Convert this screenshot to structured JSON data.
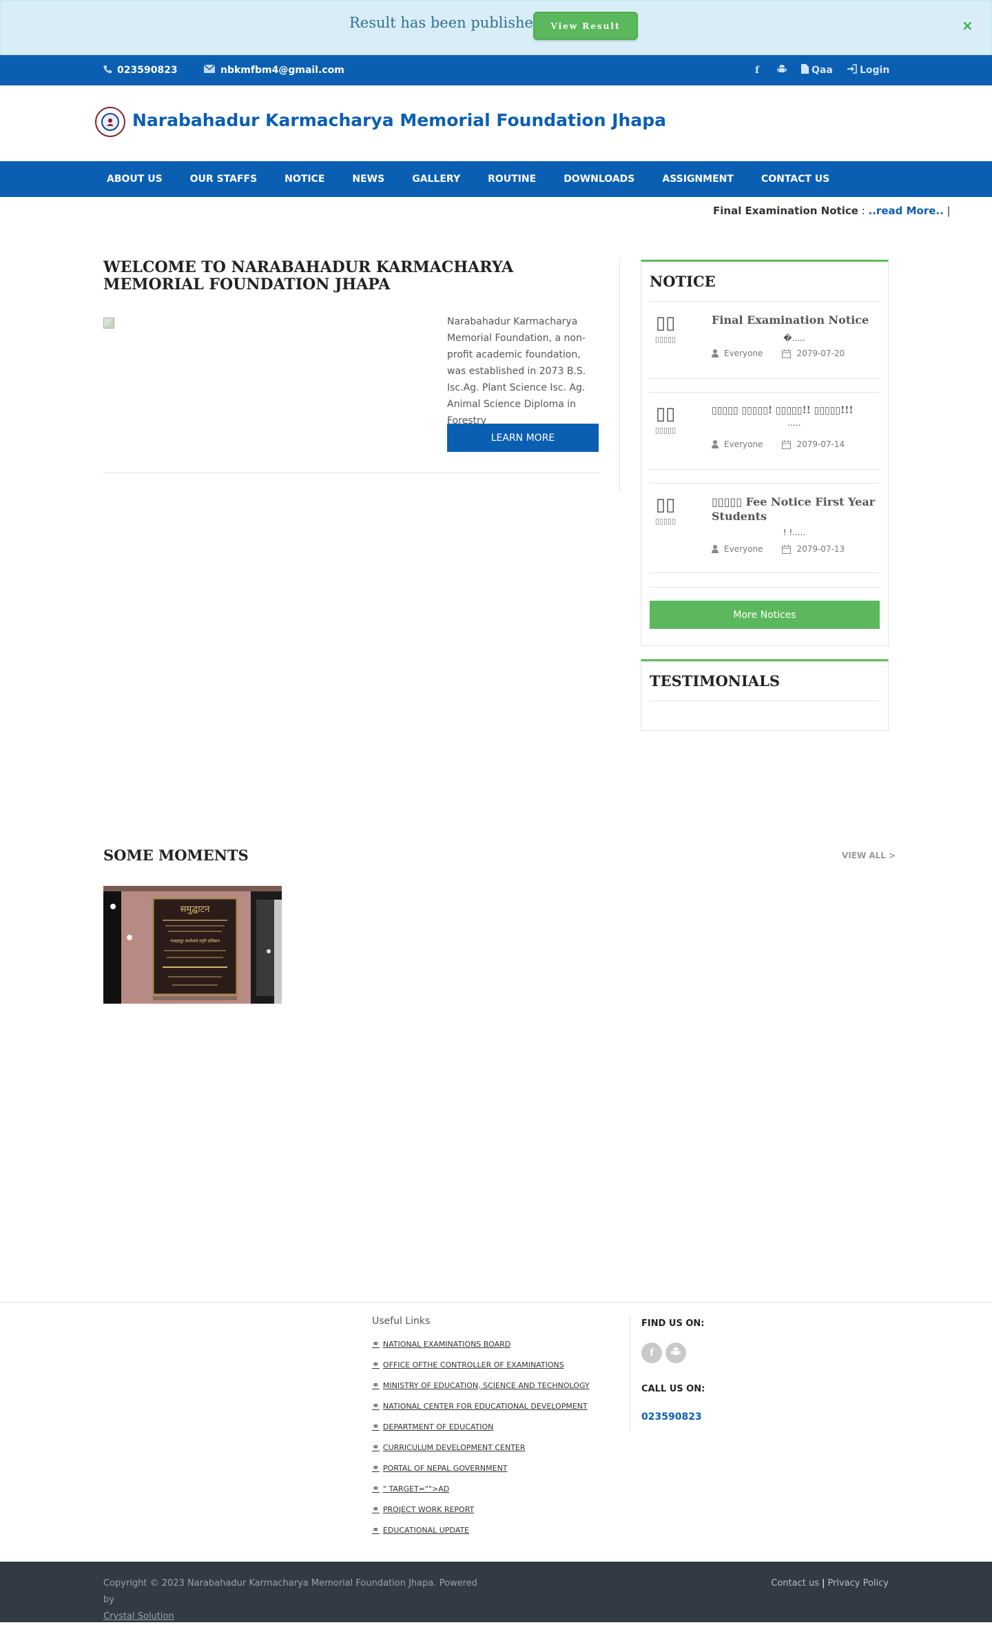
{
  "alert": {
    "message": "Result has been published.",
    "button_label": "View Result",
    "close_symbol": "×"
  },
  "topbar": {
    "phone": "023590823",
    "email": "nbkmfbm4@gmail.com",
    "qaa_label": "Qaa",
    "login_label": "Login"
  },
  "header": {
    "site_title": "Narabahadur Karmacharya Memorial Foundation Jhapa"
  },
  "nav": {
    "items": [
      "ABOUT US",
      "OUR STAFFS",
      "NOTICE",
      "NEWS",
      "GALLERY",
      "ROUTINE",
      "DOWNLOADS",
      "ASSIGNMENT",
      "CONTACT US"
    ]
  },
  "ticker": {
    "title": "Final Examination Notice",
    "separator": " : ",
    "read_more": "..read More..",
    "bar": " | ",
    "trail": "!"
  },
  "welcome": {
    "title": "WELCOME TO NARABAHADUR KARMACHARYA MEMORIAL FOUNDATION JHAPA",
    "text": "Narabahadur Karmacharya Memorial Foundation, a non-profit academic foundation, was established in 2073 B.S. Isc.Ag. Plant Science Isc. Ag. Animal Science Diploma in Forestry",
    "button_label": "LEARN MORE"
  },
  "notice": {
    "title": "NOTICE",
    "items": [
      {
        "day": "▯▯",
        "month": "▯▯▯▯▯",
        "title": "Final Examination Notice",
        "excerpt": "�.....",
        "audience": "Everyone",
        "date": "2079-07-20"
      },
      {
        "day": "▯▯",
        "month": "▯▯▯▯▯",
        "title": "▯▯▯▯▯ ▯▯▯▯▯! ▯▯▯▯▯!! ▯▯▯▯▯!!!",
        "excerpt": ".....",
        "audience": "Everyone",
        "date": "2079-07-14"
      },
      {
        "day": "▯▯",
        "month": "▯▯▯▯▯",
        "title": "▯▯▯▯▯ Fee Notice First Year Students",
        "excerpt": "!           !.....",
        "audience": "Everyone",
        "date": "2079-07-13"
      }
    ],
    "more_label": "More Notices"
  },
  "testimonials": {
    "title": "TESTIMONIALS"
  },
  "moments": {
    "title": "SOME MOMENTS",
    "view_all": "VIEW ALL >",
    "plaque_heading": "समुद्घाटन",
    "plaque_body": "नरबहादुर कर्माचार्य स्मृति प्रतिष्ठान"
  },
  "footer": {
    "links_title": "Useful Links",
    "links": [
      "NATIONAL EXAMINATIONS BOARD",
      "OFFICE OFTHE CONTROLLER OF EXAMINATIONS",
      "MINISTRY OF EDUCATION, SCIENCE AND TECHNOLOGY",
      "NATIONAL CENTER FOR EDUCATIONAL DEVELOPMENT",
      "DEPARTMENT OF EDUCATION",
      "CURRICULUM DEVELOPMENT CENTER",
      "PORTAL OF NEPAL GOVERNMENT",
      "\" TARGET=\"\">AD",
      "PROJECT WORK REPORT",
      "EDUCATIONAL UPDATE"
    ],
    "find_title": "FIND US ON:",
    "call_title": "CALL US ON:",
    "call_number": "023590823",
    "copyright": "Copyright © 2023 Narabahadur Karmacharya Memorial Foundation Jhapa. Powered by",
    "powered_by": "Crystal Solution",
    "contact_link": "Contact us",
    "privacy_link": "Privacy Policy",
    "link_separator": "|"
  },
  "colors": {
    "primary": "#0b5fb3",
    "accent_green": "#5cb85c",
    "alert_bg": "#d9edf7",
    "footer_dark": "#323a44"
  }
}
